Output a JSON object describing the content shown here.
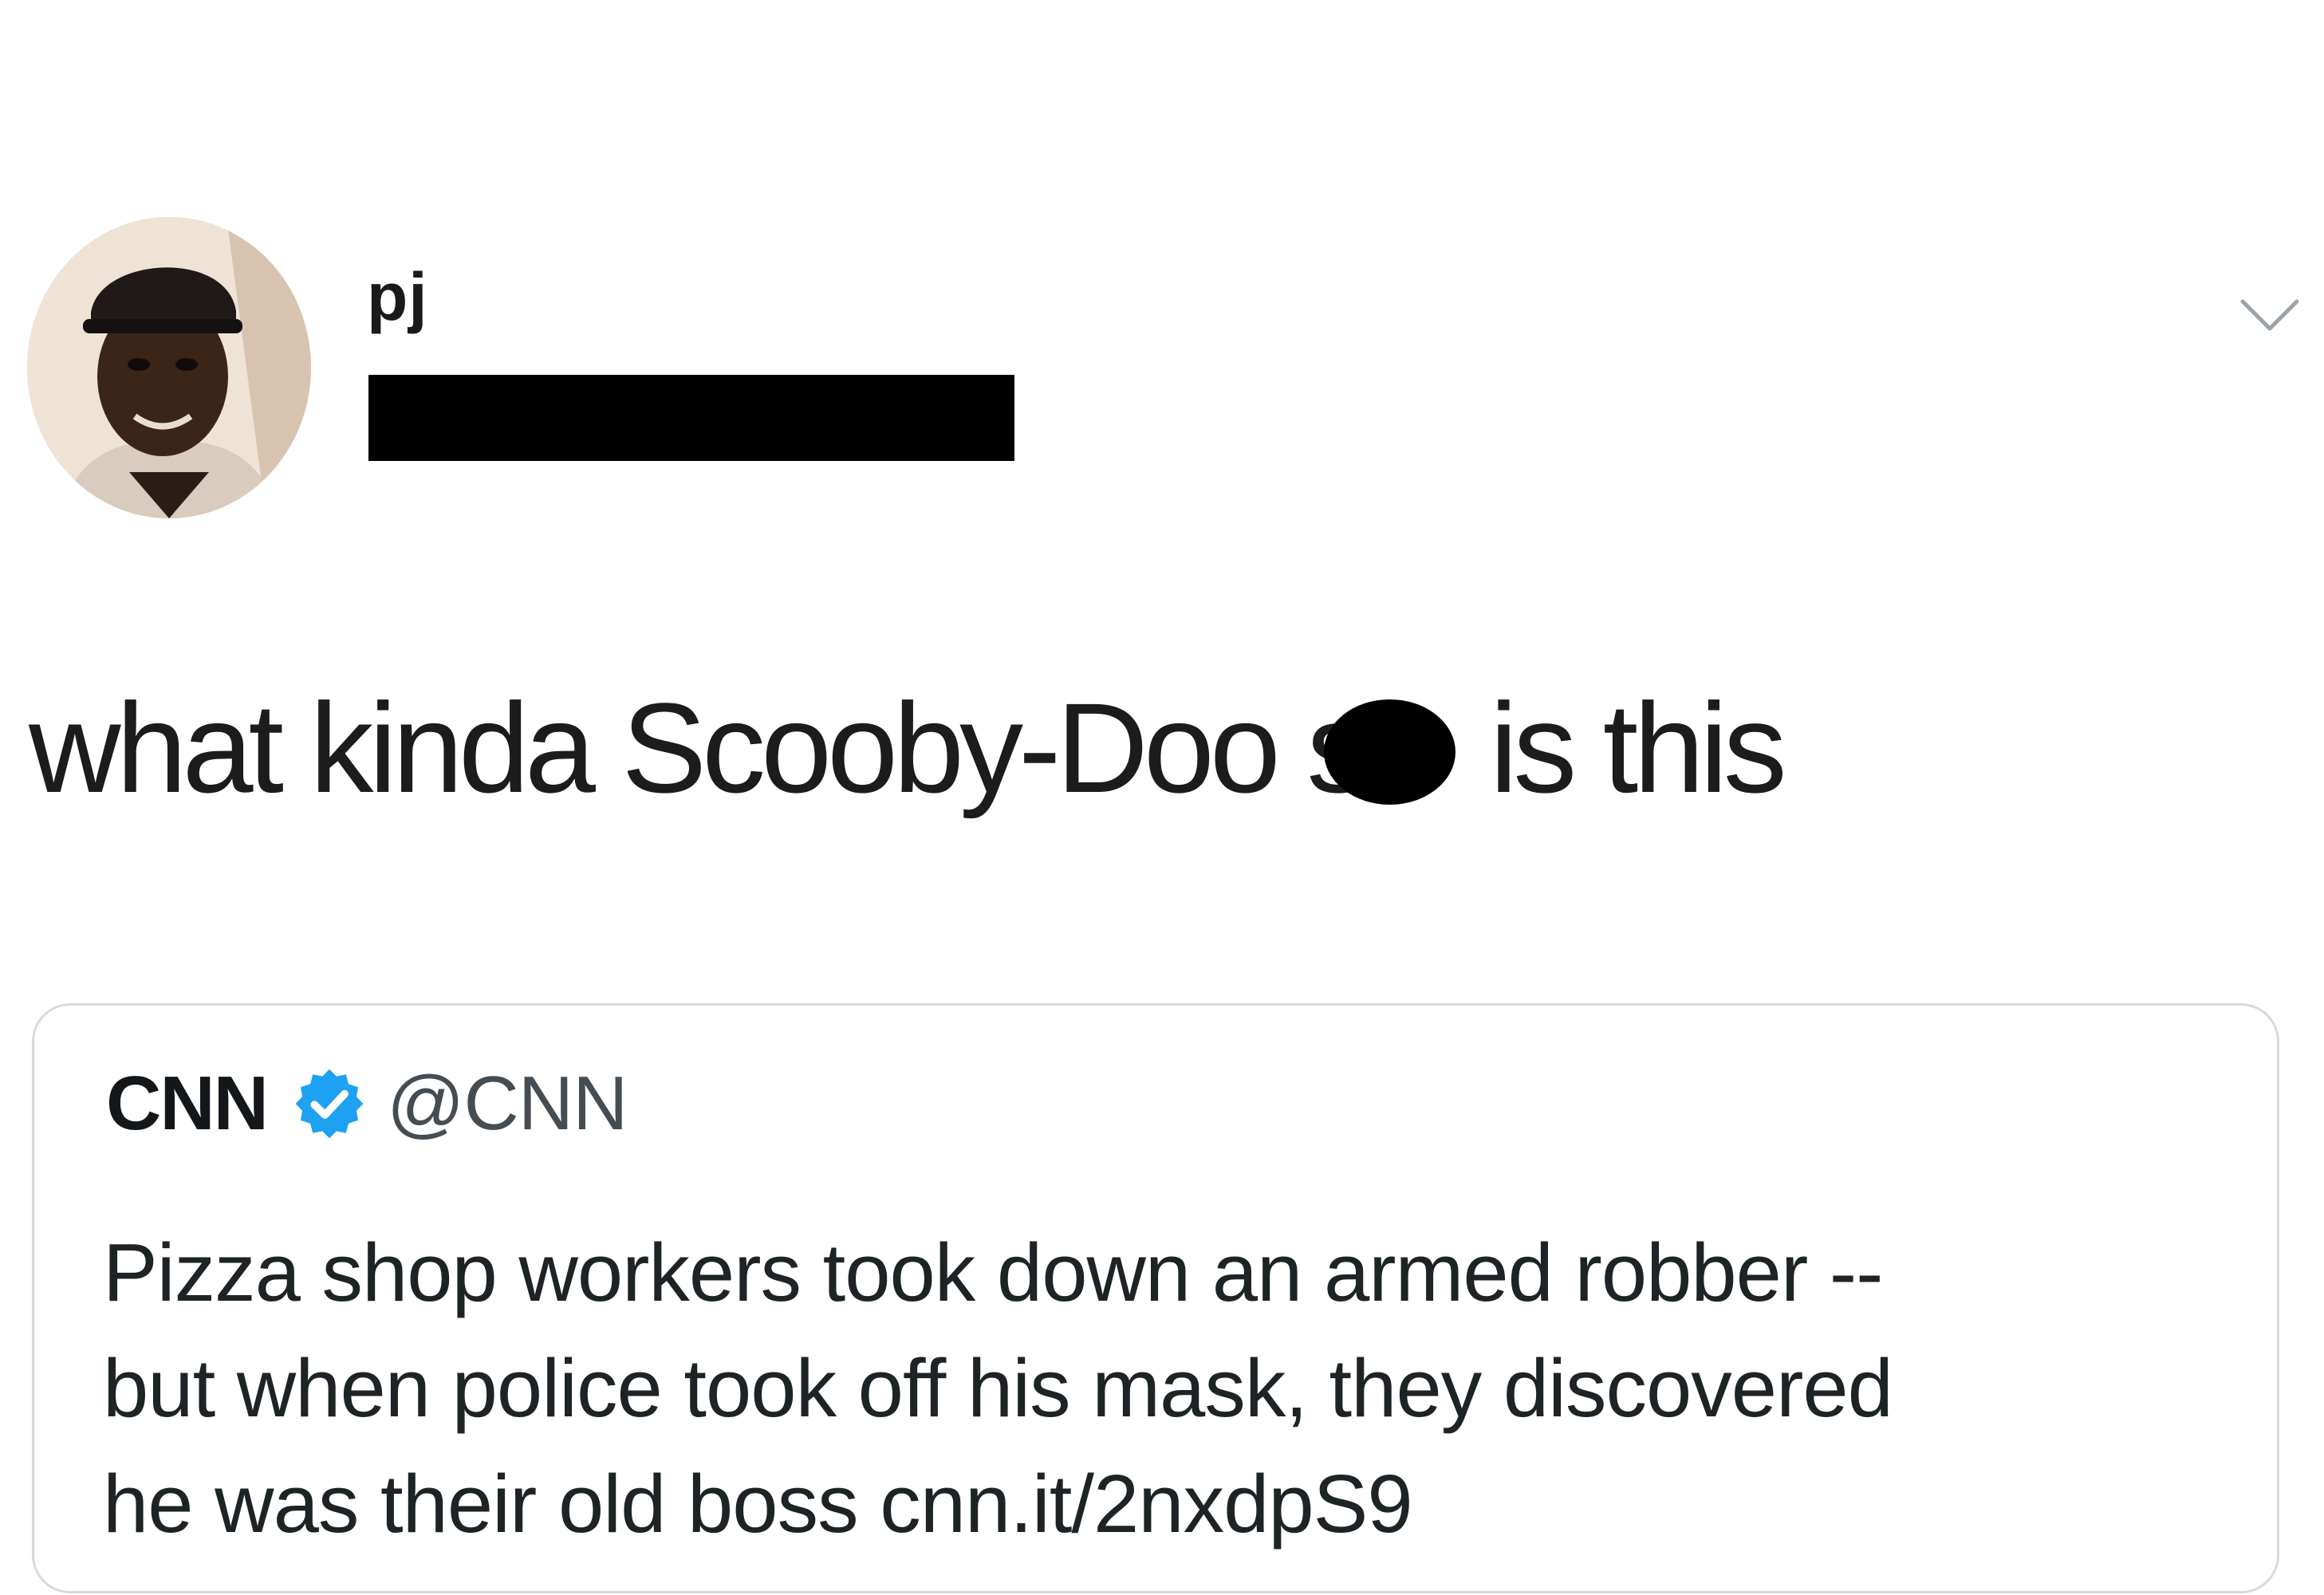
{
  "tweet": {
    "avatar_icon": "user-avatar-photo",
    "display_name": "pj",
    "caret_icon": "chevron-down-icon",
    "text_before": "what kinda Scooby-Doo s",
    "text_after": " is this"
  },
  "quote": {
    "name": "CNN",
    "verified_icon": "verified-badge-icon",
    "handle": "@CNN",
    "body_lines": [
      "Pizza shop workers took down an armed robber --",
      "but when police took off his mask, they discovered",
      "he was their old boss cnn.it/2nxdpS9"
    ]
  },
  "colors": {
    "verified_blue": "#1da1f2",
    "text": "#14171a",
    "border": "#d6dadd"
  }
}
